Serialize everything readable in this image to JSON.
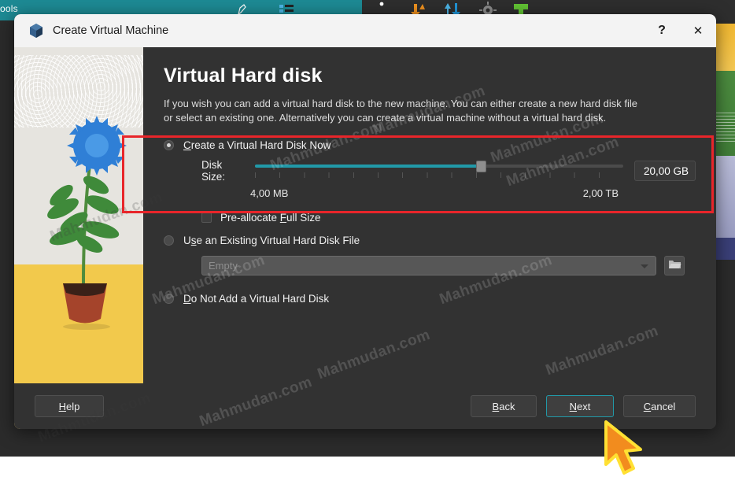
{
  "background": {
    "toolbar_label": "ools",
    "icons": [
      "pencil-icon",
      "list-icon",
      "moon-icon",
      "orange-arrows-icon",
      "blue-arrows-icon",
      "gear-icon",
      "green-plus-icon"
    ]
  },
  "dialog": {
    "title": "Create Virtual Machine",
    "title_icon": "virtualbox-cube-icon",
    "help_button": "?",
    "close_button": "✕",
    "heading": "Virtual Hard disk",
    "description": "If you wish you can add a virtual hard disk to the new machine. You can either create a new hard disk file or select an existing one. Alternatively you can create a virtual machine without a virtual hard disk.",
    "options": {
      "create_now": {
        "label_pre": "",
        "mnemonic": "C",
        "label_post": "reate a Virtual Hard Disk Now",
        "selected": true
      },
      "use_existing": {
        "label_pre": "U",
        "mnemonic": "s",
        "label_post": "e an Existing Virtual Hard Disk File",
        "selected": false
      },
      "do_not_add": {
        "label_pre": "",
        "mnemonic": "D",
        "label_post": "o Not Add a Virtual Hard Disk",
        "selected": false
      }
    },
    "disk_size": {
      "label": "Disk Size:",
      "value": "20,00 GB",
      "min": "4,00 MB",
      "max": "2,00 TB",
      "fill_percent": 62,
      "handle_percent": 60
    },
    "preallocate": {
      "label_pre": "Pre-allocate ",
      "mnemonic": "F",
      "label_post": "ull Size",
      "checked": false
    },
    "existing_file": {
      "value": "Empty",
      "dropdown_icon": "chevron-down-icon",
      "browse_icon": "folder-icon"
    },
    "footer": {
      "help": {
        "pre": "",
        "mnemonic": "H",
        "post": "elp"
      },
      "back": {
        "pre": "",
        "mnemonic": "B",
        "post": "ack"
      },
      "next": {
        "pre": "",
        "mnemonic": "N",
        "post": "ext"
      },
      "cancel": {
        "pre": "",
        "mnemonic": "C",
        "post": "ancel"
      }
    }
  },
  "annotation": {
    "highlight_color": "#e8252a"
  },
  "watermark": {
    "text": "Mahmudan.com"
  },
  "colors": {
    "accent": "#2199a8",
    "title_bar": "#f3f3f3",
    "dialog_bg": "#323232",
    "highlight": "#e8252a",
    "cursor": "#f28c1e"
  }
}
